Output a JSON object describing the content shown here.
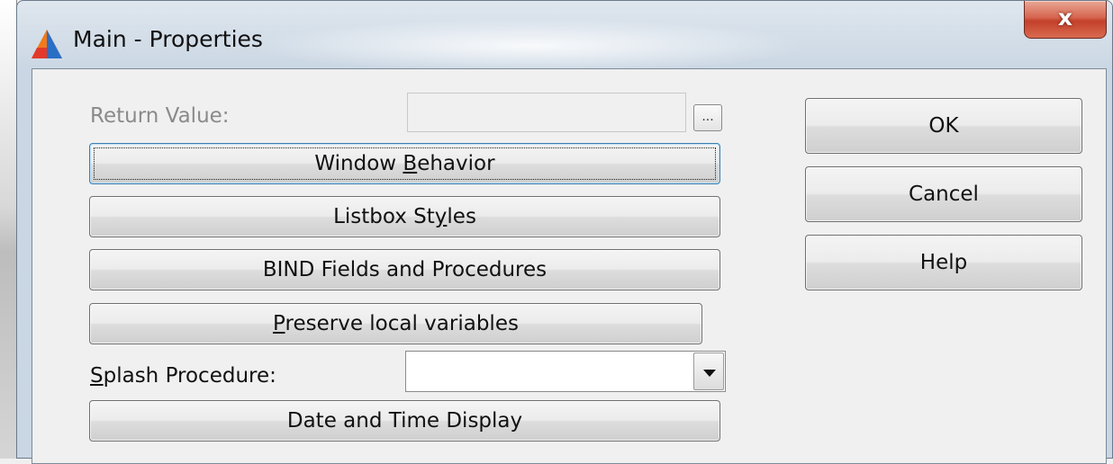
{
  "window": {
    "title": "Main - Properties",
    "close_glyph": "x",
    "app_icon": "triangle-app-icon"
  },
  "fields": {
    "return_value_label": "Return Value:",
    "return_value": "",
    "ellipsis_label": "...",
    "splash_label_mnemonic": "S",
    "splash_label_rest": "plash Procedure:",
    "splash_value": ""
  },
  "buttons": {
    "window_behavior_pre": "Window ",
    "window_behavior_mnemonic": "B",
    "window_behavior_post": "ehavior",
    "listbox_pre": "Listbox St",
    "listbox_mnemonic": "y",
    "listbox_post": "les",
    "bind_fields": "BIND Fields and Procedures",
    "preserve_mnemonic": "P",
    "preserve_post": "reserve local variables",
    "date_time": "Date and Time Display",
    "ok": "OK",
    "cancel": "Cancel",
    "help": "Help"
  },
  "colors": {
    "close_button": "#c3402a",
    "focus_border": "#3c7fb1"
  }
}
